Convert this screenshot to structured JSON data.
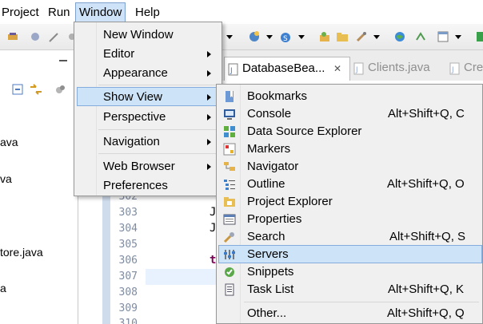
{
  "menubar": {
    "items": [
      "Project",
      "Run",
      "Window",
      "Help"
    ]
  },
  "left_panel": {
    "fragments": [
      "ava",
      "va",
      "tore.java",
      "a"
    ]
  },
  "editor": {
    "tabs": [
      {
        "label": "DatabaseBea...",
        "close": "✕"
      },
      {
        "label": "Clients.java"
      },
      {
        "label": "Cre"
      }
    ],
    "line_numbers": [
      "302",
      "303",
      "304",
      "305",
      "306",
      "307",
      "308",
      "309",
      "310"
    ],
    "code_fragments": [
      "J",
      "J",
      "t"
    ]
  },
  "window_menu": {
    "items": [
      {
        "label": "New Window",
        "submenu": false
      },
      {
        "label": "Editor",
        "submenu": true
      },
      {
        "label": "Appearance",
        "submenu": true
      },
      {
        "label": "Show View",
        "submenu": true,
        "highlighted": true
      },
      {
        "label": "Perspective",
        "submenu": true
      },
      {
        "label": "Navigation",
        "submenu": true
      },
      {
        "label": "Web Browser",
        "submenu": true
      },
      {
        "label": "Preferences",
        "submenu": false
      }
    ]
  },
  "show_view_menu": {
    "items": [
      {
        "label": "Bookmarks",
        "shortcut": "",
        "icon": "bookmark-icon"
      },
      {
        "label": "Console",
        "shortcut": "Alt+Shift+Q, C",
        "icon": "console-icon"
      },
      {
        "label": "Data Source Explorer",
        "shortcut": "",
        "icon": "data-source-icon"
      },
      {
        "label": "Markers",
        "shortcut": "",
        "icon": "markers-icon"
      },
      {
        "label": "Navigator",
        "shortcut": "",
        "icon": "navigator-icon"
      },
      {
        "label": "Outline",
        "shortcut": "Alt+Shift+Q, O",
        "icon": "outline-icon"
      },
      {
        "label": "Project Explorer",
        "shortcut": "",
        "icon": "project-explorer-icon"
      },
      {
        "label": "Properties",
        "shortcut": "",
        "icon": "properties-icon"
      },
      {
        "label": "Search",
        "shortcut": "Alt+Shift+Q, S",
        "icon": "search-icon"
      },
      {
        "label": "Servers",
        "shortcut": "",
        "icon": "servers-icon",
        "highlighted": true
      },
      {
        "label": "Snippets",
        "shortcut": "",
        "icon": "snippets-icon"
      },
      {
        "label": "Task List",
        "shortcut": "Alt+Shift+Q, K",
        "icon": "task-list-icon"
      },
      {
        "label": "Other...",
        "shortcut": "Alt+Shift+Q, Q",
        "icon": ""
      }
    ]
  },
  "colors": {
    "menu_background": "#f0f0f0",
    "highlight": "#cde3f7",
    "highlight_border": "#84acdd",
    "gutter": "#cfdcec"
  }
}
